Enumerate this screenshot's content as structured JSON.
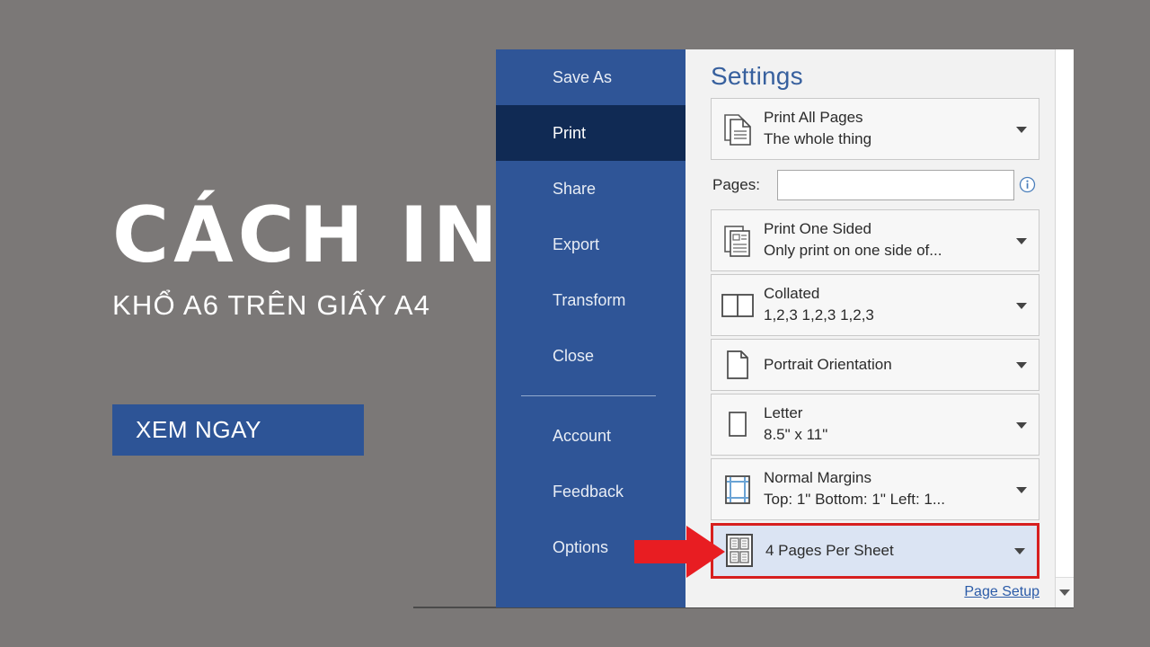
{
  "promo": {
    "title": "CÁCH IN",
    "subtitle": "KHỔ A6 TRÊN GIẤY A4",
    "cta_label": "XEM NGAY",
    "accent_color": "#2d5496",
    "background_color": "#7b7877"
  },
  "backstage": {
    "sidebar": {
      "items": [
        {
          "label": "Save As",
          "active": false
        },
        {
          "label": "Print",
          "active": true
        },
        {
          "label": "Share",
          "active": false
        },
        {
          "label": "Export",
          "active": false
        },
        {
          "label": "Transform",
          "active": false
        },
        {
          "label": "Close",
          "active": false
        }
      ],
      "footer_items": [
        {
          "label": "Account"
        },
        {
          "label": "Feedback"
        },
        {
          "label": "Options"
        }
      ],
      "background_color": "#2f5597",
      "active_color": "#102a54"
    },
    "settings": {
      "title": "Settings",
      "options": [
        {
          "icon": "print-all-pages-icon",
          "primary": "Print All Pages",
          "secondary": "The whole thing",
          "highlighted": false
        },
        {
          "icon": "print-one-sided-icon",
          "primary": "Print One Sided",
          "secondary": "Only print on one side of...",
          "highlighted": false
        },
        {
          "icon": "collated-icon",
          "primary": "Collated",
          "secondary": "1,2,3   1,2,3   1,2,3",
          "highlighted": false
        },
        {
          "icon": "portrait-orientation-icon",
          "primary": "Portrait Orientation",
          "secondary": "",
          "highlighted": false
        },
        {
          "icon": "paper-size-icon",
          "primary": "Letter",
          "secondary": "8.5\" x 11\"",
          "highlighted": false
        },
        {
          "icon": "margins-icon",
          "primary": "Normal Margins",
          "secondary": "Top: 1\" Bottom: 1\" Left: 1...",
          "highlighted": false
        },
        {
          "icon": "pages-per-sheet-icon",
          "primary": "4 Pages Per Sheet",
          "secondary": "",
          "highlighted": true
        }
      ],
      "pages_field": {
        "label": "Pages:",
        "value": "",
        "placeholder": "",
        "info_icon": "info-icon"
      },
      "page_setup_label": "Page Setup",
      "highlight_border_color": "#d71f1f",
      "highlight_fill_color": "#dbe4f3",
      "title_color": "#37609e"
    },
    "scrollbar": {
      "down_icon": "chevron-down-icon"
    },
    "annotation": {
      "icon": "red-arrow-icon",
      "color": "#e81d22"
    }
  }
}
